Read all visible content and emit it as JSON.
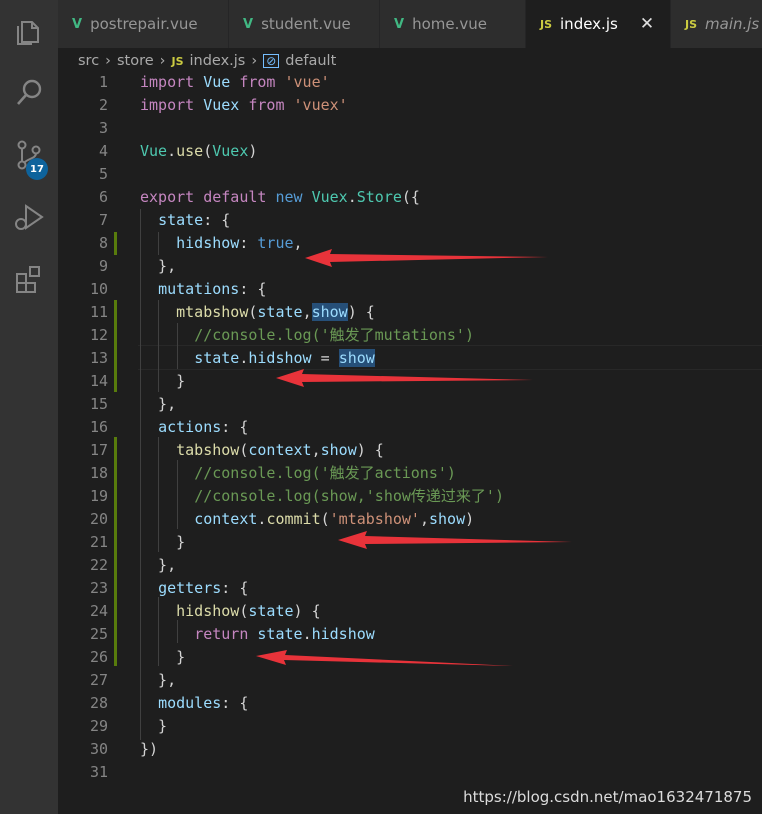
{
  "tabs": [
    {
      "label": "postrepair.vue",
      "icon": "vue-icon"
    },
    {
      "label": "student.vue",
      "icon": "vue-icon"
    },
    {
      "label": "home.vue",
      "icon": "vue-icon"
    },
    {
      "label": "index.js",
      "icon": "js-icon",
      "active": true
    },
    {
      "label": "main.js",
      "icon": "js-icon"
    }
  ],
  "tab_icon_js": "JS",
  "tab_icon_vue": "V",
  "breadcrumb": {
    "folder1": "src",
    "folder2": "store",
    "file": "index.js",
    "symbol": "default",
    "js_icon": "JS"
  },
  "scm_badge": "17",
  "code_lines": [
    "import Vue from 'vue'",
    "import Vuex from 'vuex'",
    "",
    "Vue.use(Vuex)",
    "",
    "export default new Vuex.Store({",
    "  state: {",
    "    hidshow: true,",
    "  },",
    "  mutations: {",
    "    mtabshow(state,show) {",
    "      //console.log('触发了mutations')",
    "      state.hidshow = show",
    "    }",
    "  },",
    "  actions: {",
    "    tabshow(context,show) {",
    "      //console.log('触发了actions')",
    "      //console.log(show,'show传递过来了')",
    "      context.commit('mtabshow',show)",
    "    }",
    "  },",
    "  getters: {",
    "    hidshow(state) {",
    "      return state.hidshow",
    "    }",
    "  },",
    "  modules: {",
    "  }",
    "})",
    ""
  ],
  "line_numbers": [
    "1",
    "2",
    "3",
    "4",
    "5",
    "6",
    "7",
    "8",
    "9",
    "10",
    "11",
    "12",
    "13",
    "14",
    "15",
    "16",
    "17",
    "18",
    "19",
    "20",
    "21",
    "22",
    "23",
    "24",
    "25",
    "26",
    "27",
    "28",
    "29",
    "30",
    "31"
  ],
  "watermark": "https://blog.csdn.net/mao1632471875",
  "colors": {
    "keyword": "#c586c0",
    "storage": "#569cd6",
    "string": "#ce9178",
    "class": "#4ec9b0",
    "function": "#dcdcaa",
    "variable": "#9cdcfe",
    "comment": "#6a9955",
    "arrow": "#e8333a"
  }
}
